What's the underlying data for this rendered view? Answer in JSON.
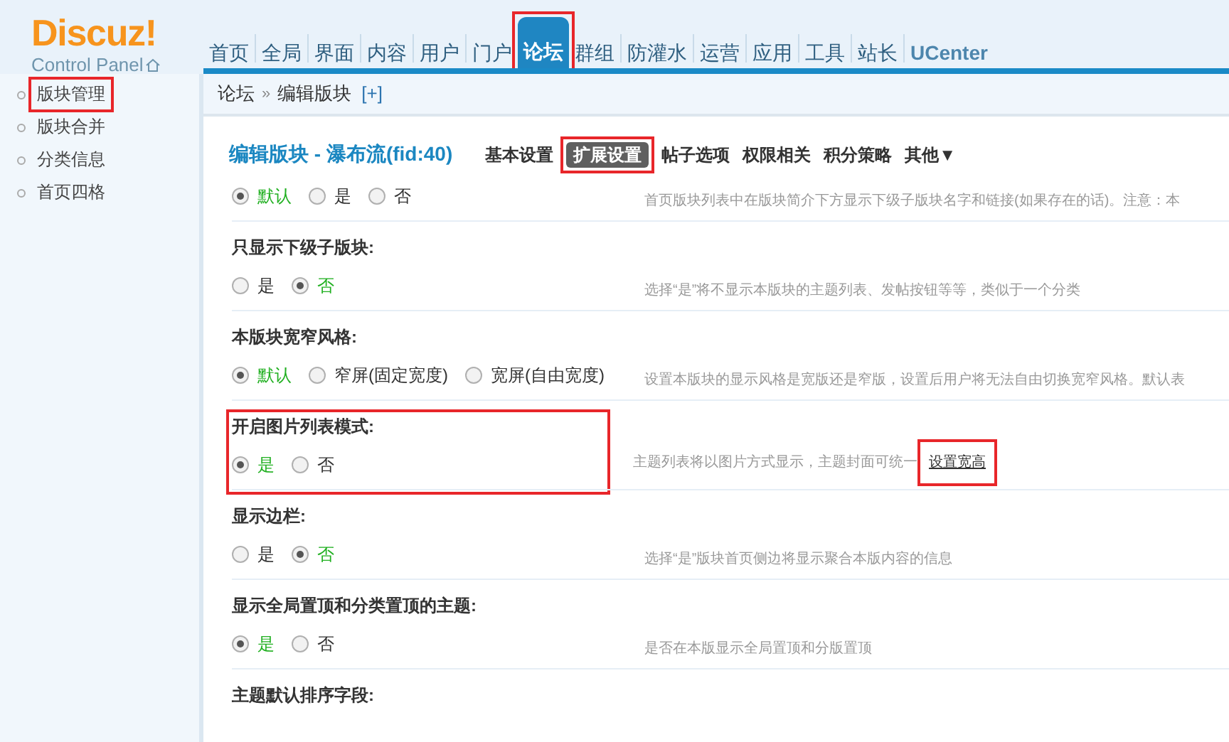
{
  "logo": {
    "name": "Discuz",
    "mark": "!",
    "subtitle": "Control Panel"
  },
  "nav": [
    {
      "label": "首页",
      "selected": false,
      "highlighted": false
    },
    {
      "label": "全局",
      "selected": false,
      "highlighted": false
    },
    {
      "label": "界面",
      "selected": false,
      "highlighted": false
    },
    {
      "label": "内容",
      "selected": false,
      "highlighted": false
    },
    {
      "label": "用户",
      "selected": false,
      "highlighted": false
    },
    {
      "label": "门户",
      "selected": false,
      "highlighted": false
    },
    {
      "label": "论坛",
      "selected": true,
      "highlighted": true
    },
    {
      "label": "群组",
      "selected": false,
      "highlighted": false
    },
    {
      "label": "防灌水",
      "selected": false,
      "highlighted": false
    },
    {
      "label": "运营",
      "selected": false,
      "highlighted": false
    },
    {
      "label": "应用",
      "selected": false,
      "highlighted": false
    },
    {
      "label": "工具",
      "selected": false,
      "highlighted": false
    },
    {
      "label": "站长",
      "selected": false,
      "highlighted": false
    },
    {
      "label": "UCenter",
      "selected": false,
      "highlighted": false
    }
  ],
  "breadcrumb": {
    "items": [
      "论坛",
      "编辑版块"
    ],
    "separator": "»",
    "add": "[+]"
  },
  "sidebar": [
    {
      "label": "版块管理",
      "highlighted": true
    },
    {
      "label": "版块合并",
      "highlighted": false
    },
    {
      "label": "分类信息",
      "highlighted": false
    },
    {
      "label": "首页四格",
      "highlighted": false
    }
  ],
  "page_title": "编辑版块 - 瀑布流(fid:40)",
  "tabs": [
    {
      "label": "基本设置",
      "selected": false,
      "highlighted": false
    },
    {
      "label": "扩展设置",
      "selected": true,
      "highlighted": true
    },
    {
      "label": "帖子选项",
      "selected": false,
      "highlighted": false
    },
    {
      "label": "权限相关",
      "selected": false,
      "highlighted": false
    },
    {
      "label": "积分策略",
      "selected": false,
      "highlighted": false
    },
    {
      "label": "其他▼",
      "selected": false,
      "highlighted": false
    }
  ],
  "settings": [
    {
      "highlighted": false,
      "options": [
        {
          "label": "默认",
          "selected": true
        },
        {
          "label": "是",
          "selected": false
        },
        {
          "label": "否",
          "selected": false
        }
      ],
      "description": "首页版块列表中在版块简介下方显示下级子版块名字和链接(如果存在的话)。注意：本"
    },
    {
      "title": "只显示下级子版块:",
      "highlighted": false,
      "options": [
        {
          "label": "是",
          "selected": false
        },
        {
          "label": "否",
          "selected": true
        }
      ],
      "description": "选择“是”将不显示本版块的主题列表、发帖按钮等等，类似于一个分类"
    },
    {
      "title": "本版块宽窄风格:",
      "highlighted": false,
      "options": [
        {
          "label": "默认",
          "selected": true
        },
        {
          "label": "窄屏(固定宽度)",
          "selected": false
        },
        {
          "label": "宽屏(自由宽度)",
          "selected": false
        }
      ],
      "description": "设置本版块的显示风格是宽版还是窄版，设置后用户将无法自由切换宽窄风格。默认表"
    },
    {
      "title": "开启图片列表模式:",
      "highlighted": true,
      "options": [
        {
          "label": "是",
          "selected": true
        },
        {
          "label": "否",
          "selected": false
        }
      ],
      "description": "主题列表将以图片方式显示，主题封面可统一",
      "link": {
        "label": "设置宽高",
        "highlighted": true
      }
    },
    {
      "title": "显示边栏:",
      "highlighted": false,
      "options": [
        {
          "label": "是",
          "selected": false
        },
        {
          "label": "否",
          "selected": true
        }
      ],
      "description": "选择“是”版块首页侧边将显示聚合本版内容的信息"
    },
    {
      "title": "显示全局置顶和分类置顶的主题:",
      "highlighted": false,
      "options": [
        {
          "label": "是",
          "selected": true
        },
        {
          "label": "否",
          "selected": false
        }
      ],
      "description": "是否在本版显示全局置顶和分版置顶"
    },
    {
      "title": "主题默认排序字段:",
      "highlighted": false
    }
  ]
}
